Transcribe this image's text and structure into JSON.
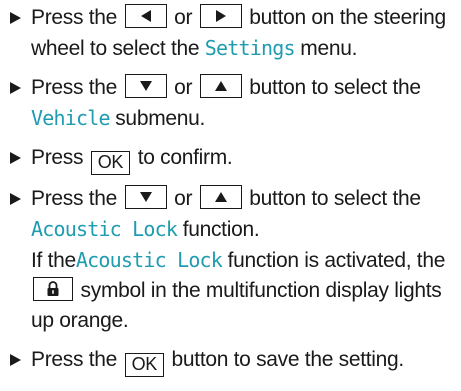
{
  "steps": [
    {
      "parts": [
        "Press the",
        "or",
        "button on the steering wheel to select the",
        "Settings",
        "menu."
      ]
    },
    {
      "parts": [
        "Press the",
        "or",
        "button to select the",
        "Vehicle",
        "submenu."
      ]
    },
    {
      "parts": [
        "Press",
        "OK",
        "to confirm."
      ]
    },
    {
      "parts": [
        "Press the",
        "or",
        "button to select the",
        "Acoustic Lock",
        "function.",
        "If the",
        "Acoustic Lock",
        "function is activated, the",
        "symbol in the multifunction display lights up orange."
      ]
    },
    {
      "parts": [
        "Press the",
        "OK",
        "button to save the setting."
      ]
    }
  ],
  "icons": {
    "left": "triangle-left-icon",
    "right": "triangle-right-icon",
    "down": "triangle-down-icon",
    "up": "triangle-up-icon",
    "lock": "padlock-icon",
    "bullet": "triangle-bullet-icon"
  },
  "colors": {
    "text": "#1a1a1a",
    "term": "#1f9cb0"
  }
}
